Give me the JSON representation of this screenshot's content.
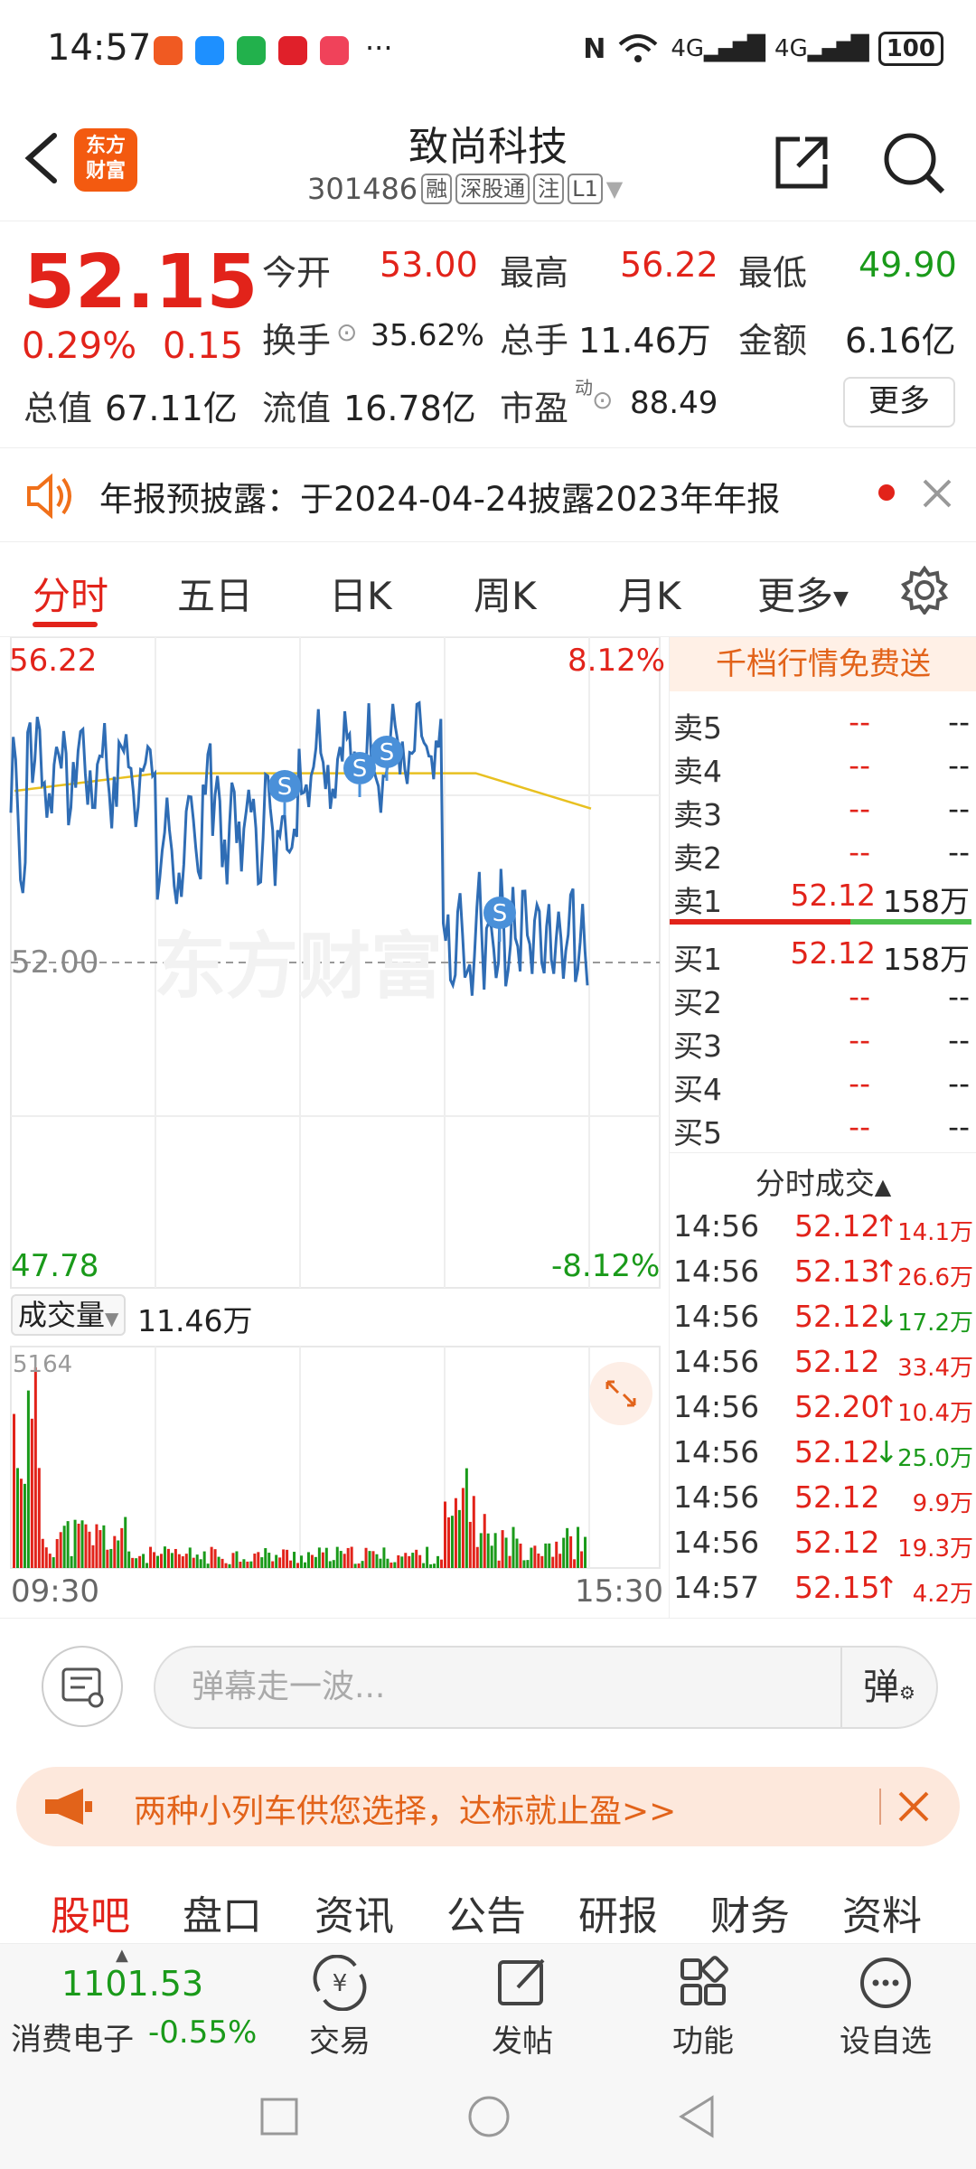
{
  "status_bar": {
    "time": "14:57",
    "more": "···",
    "network1": "4G",
    "network2": "4G",
    "battery": "100"
  },
  "header": {
    "logo_line1": "东方",
    "logo_line2": "财富",
    "stock_name": "致尚科技",
    "stock_code": "301486",
    "tags": [
      "融",
      "深股通",
      "注",
      "L1"
    ]
  },
  "quote": {
    "price": "52.15",
    "change_pct": "0.29%",
    "change": "0.15",
    "open_label": "今开",
    "open": "53.00",
    "high_label": "最高",
    "high": "56.22",
    "low_label": "最低",
    "low": "49.90",
    "turnover_label": "换手",
    "turnover": "35.62%",
    "volume_label": "总手",
    "volume": "11.46万",
    "amount_label": "金额",
    "amount": "6.16亿",
    "mktcap_label": "总值",
    "mktcap": "67.11亿",
    "float_label": "流值",
    "float": "16.78亿",
    "pe_label": "市盈",
    "pe_sup": "动",
    "pe": "88.49",
    "more_label": "更多"
  },
  "notice": {
    "text": "年报预披露：于2024-04-24披露2023年年报"
  },
  "tabs": [
    "分时",
    "五日",
    "日K",
    "周K",
    "月K",
    "更多"
  ],
  "chart_labels": {
    "top_price": "56.22",
    "top_pct": "8.12%",
    "mid_price": "52.00",
    "bottom_price": "47.78",
    "bottom_pct": "-8.12%",
    "watermark": "东方财富",
    "volume_label": "成交量",
    "volume_value": "11.46万",
    "volume_max": "5164",
    "time_start": "09:30",
    "time_end": "15:30",
    "signal": "S"
  },
  "orderbook": {
    "banner": "千档行情免费送",
    "asks": [
      {
        "label": "卖5",
        "price": "--",
        "vol": "--"
      },
      {
        "label": "卖4",
        "price": "--",
        "vol": "--"
      },
      {
        "label": "卖3",
        "price": "--",
        "vol": "--"
      },
      {
        "label": "卖2",
        "price": "--",
        "vol": "--"
      },
      {
        "label": "卖1",
        "price": "52.12",
        "vol": "158万"
      }
    ],
    "bids": [
      {
        "label": "买1",
        "price": "52.12",
        "vol": "158万"
      },
      {
        "label": "买2",
        "price": "--",
        "vol": "--"
      },
      {
        "label": "买3",
        "price": "--",
        "vol": "--"
      },
      {
        "label": "买4",
        "price": "--",
        "vol": "--"
      },
      {
        "label": "买5",
        "price": "--",
        "vol": "--"
      }
    ],
    "trades_title": "分时成交",
    "trades": [
      {
        "time": "14:56",
        "price": "52.12",
        "dir": "↑",
        "vol": "14.1万",
        "color": "#e2231a"
      },
      {
        "time": "14:56",
        "price": "52.13",
        "dir": "↑",
        "vol": "26.6万",
        "color": "#e2231a"
      },
      {
        "time": "14:56",
        "price": "52.12",
        "dir": "↓",
        "vol": "17.2万",
        "color": "#1a9a1a"
      },
      {
        "time": "14:56",
        "price": "52.12",
        "dir": "",
        "vol": "33.4万",
        "color": "#e2231a"
      },
      {
        "time": "14:56",
        "price": "52.20",
        "dir": "↑",
        "vol": "10.4万",
        "color": "#e2231a"
      },
      {
        "time": "14:56",
        "price": "52.12",
        "dir": "↓",
        "vol": "25.0万",
        "color": "#1a9a1a"
      },
      {
        "time": "14:56",
        "price": "52.12",
        "dir": "",
        "vol": "9.9万",
        "color": "#e2231a"
      },
      {
        "time": "14:56",
        "price": "52.12",
        "dir": "",
        "vol": "19.3万",
        "color": "#e2231a"
      },
      {
        "time": "14:57",
        "price": "52.15",
        "dir": "↑",
        "vol": "4.2万",
        "color": "#e2231a"
      }
    ]
  },
  "danmu": {
    "placeholder": "弹幕走一波...",
    "send_label": "弹"
  },
  "promo": {
    "text": "两种小列车供您选择，达标就止盈>>"
  },
  "subnav": [
    "股吧",
    "盘口",
    "资讯",
    "公告",
    "研报",
    "财务",
    "资料"
  ],
  "bottombar": {
    "index_value": "1101.53",
    "index_name": "消费电子",
    "index_pct": "-0.55%",
    "items": [
      "交易",
      "发帖",
      "功能",
      "设自选"
    ]
  },
  "colors": {
    "up": "#e2231a",
    "down": "#1a9a1a",
    "price_line": "#2f6db5",
    "avg_line": "#e8c020",
    "accent": "#f35a10"
  }
}
